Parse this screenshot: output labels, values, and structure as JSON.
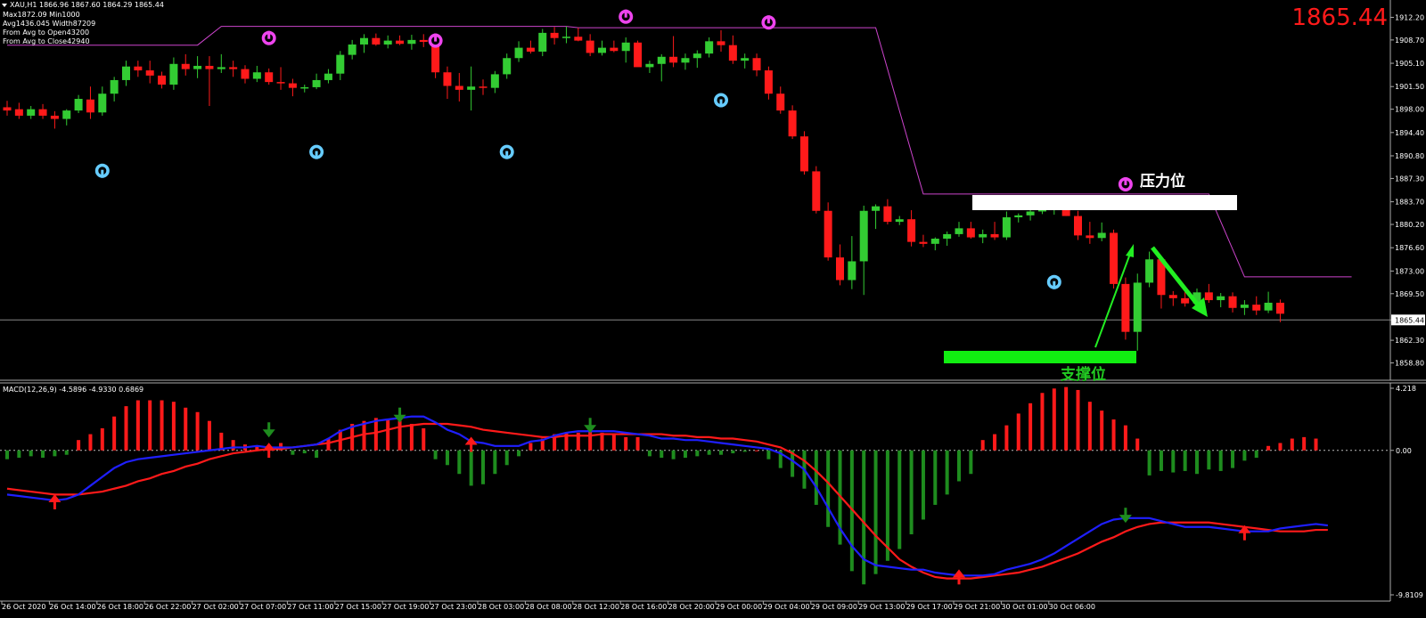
{
  "header": {
    "symbol_line": "XAU,H1  1866.96 1867.60 1864.29 1865.44",
    "info_lines": [
      "Max1872.09 Min1000",
      "Avg1436.045 Width87209",
      "From Avg to Open43200",
      "From Avg to Close42940"
    ],
    "big_price": "1865.44"
  },
  "annotations": {
    "resistance_label": "压力位",
    "support_label": "支撑位"
  },
  "colors": {
    "bull": "#33cc33",
    "bear": "#ff1a1a",
    "macd_blue": "#1f1fff",
    "macd_red": "#ff1a1a",
    "trail": "#cc44cc",
    "fractal_up": "#66ccff",
    "fractal_down": "#ee44ee",
    "grid": "#888888"
  },
  "macd_header": "MACD(12,26,9) -4.5896 -4.9330 0.6869",
  "chart_data": [
    {
      "type": "candlestick",
      "symbol": "XAU",
      "timeframe": "H1",
      "ylim": [
        1857.5,
        1913.5
      ],
      "yticks": [
        "1912.20",
        "1908.70",
        "1905.10",
        "1901.50",
        "1898.00",
        "1894.40",
        "1890.80",
        "1887.30",
        "1883.70",
        "1880.20",
        "1876.60",
        "1873.00",
        "1869.50",
        "1865.44",
        "1862.30",
        "1858.80"
      ],
      "current_price": 1865.44,
      "xticks": [
        "26 Oct 2020",
        "26 Oct 14:00",
        "26 Oct 18:00",
        "26 Oct 22:00",
        "27 Oct 02:00",
        "27 Oct 07:00",
        "27 Oct 11:00",
        "27 Oct 15:00",
        "27 Oct 19:00",
        "27 Oct 23:00",
        "28 Oct 03:00",
        "28 Oct 08:00",
        "28 Oct 12:00",
        "28 Oct 16:00",
        "28 Oct 20:00",
        "29 Oct 00:00",
        "29 Oct 04:00",
        "29 Oct 09:00",
        "29 Oct 13:00",
        "29 Oct 17:00",
        "29 Oct 21:00",
        "30 Oct 01:00",
        "30 Oct 06:00"
      ],
      "candles": [
        [
          1898.3,
          1899.3,
          1897.0,
          1897.8
        ],
        [
          1898.0,
          1899.0,
          1896.5,
          1897.0
        ],
        [
          1897.0,
          1898.5,
          1896.5,
          1898.0
        ],
        [
          1898.0,
          1898.8,
          1896.5,
          1897.0
        ],
        [
          1897.0,
          1897.7,
          1895.0,
          1896.5
        ],
        [
          1896.5,
          1898.0,
          1895.5,
          1897.8
        ],
        [
          1897.8,
          1900.2,
          1897.4,
          1899.6
        ],
        [
          1899.5,
          1901.5,
          1896.5,
          1897.5
        ],
        [
          1897.5,
          1901.5,
          1897.0,
          1900.4
        ],
        [
          1900.4,
          1903.0,
          1899.2,
          1902.5
        ],
        [
          1902.5,
          1905.5,
          1901.6,
          1904.6
        ],
        [
          1904.6,
          1905.5,
          1903.0,
          1904.0
        ],
        [
          1904.0,
          1905.5,
          1902.0,
          1903.2
        ],
        [
          1903.2,
          1903.8,
          1901.2,
          1901.8
        ],
        [
          1901.8,
          1906.0,
          1901.0,
          1905.0
        ],
        [
          1905.0,
          1906.5,
          1903.2,
          1904.2
        ],
        [
          1904.2,
          1906.2,
          1902.8,
          1904.7
        ],
        [
          1904.7,
          1906.2,
          1898.5,
          1904.2
        ],
        [
          1904.2,
          1906.5,
          1903.6,
          1904.5
        ],
        [
          1904.5,
          1905.5,
          1903.0,
          1904.2
        ],
        [
          1904.2,
          1904.8,
          1902.0,
          1902.7
        ],
        [
          1902.7,
          1904.7,
          1902.2,
          1903.7
        ],
        [
          1903.7,
          1904.3,
          1901.8,
          1902.2
        ],
        [
          1902.2,
          1904.5,
          1901.0,
          1902.0
        ],
        [
          1902.0,
          1902.7,
          1900.0,
          1901.3
        ],
        [
          1901.3,
          1901.8,
          1900.6,
          1901.4
        ],
        [
          1901.4,
          1903.5,
          1901.1,
          1902.5
        ],
        [
          1902.5,
          1904.2,
          1902.0,
          1903.5
        ],
        [
          1903.5,
          1907.0,
          1902.5,
          1906.4
        ],
        [
          1906.4,
          1908.7,
          1905.7,
          1908.0
        ],
        [
          1908.0,
          1909.6,
          1906.7,
          1909.0
        ],
        [
          1909.0,
          1909.7,
          1907.8,
          1908.0
        ],
        [
          1908.0,
          1909.4,
          1907.4,
          1908.6
        ],
        [
          1908.6,
          1909.4,
          1907.9,
          1908.1
        ],
        [
          1908.1,
          1909.5,
          1907.2,
          1908.7
        ],
        [
          1908.7,
          1909.6,
          1907.6,
          1908.4
        ],
        [
          1908.4,
          1909.5,
          1902.8,
          1903.7
        ],
        [
          1903.7,
          1904.6,
          1899.6,
          1901.6
        ],
        [
          1901.6,
          1903.6,
          1899.2,
          1901.0
        ],
        [
          1901.0,
          1904.6,
          1897.8,
          1901.5
        ],
        [
          1901.5,
          1902.6,
          1900.2,
          1901.3
        ],
        [
          1901.3,
          1903.9,
          1900.5,
          1903.4
        ],
        [
          1903.4,
          1906.6,
          1902.7,
          1905.9
        ],
        [
          1905.9,
          1908.5,
          1905.3,
          1907.5
        ],
        [
          1907.5,
          1908.6,
          1906.6,
          1906.9
        ],
        [
          1906.9,
          1910.4,
          1906.2,
          1909.8
        ],
        [
          1909.8,
          1910.7,
          1908.0,
          1909.0
        ],
        [
          1909.0,
          1910.8,
          1908.2,
          1909.2
        ],
        [
          1909.2,
          1910.6,
          1908.5,
          1908.6
        ],
        [
          1908.6,
          1909.6,
          1906.2,
          1906.7
        ],
        [
          1906.7,
          1908.6,
          1906.3,
          1907.5
        ],
        [
          1907.5,
          1908.6,
          1906.8,
          1907.0
        ],
        [
          1907.0,
          1909.1,
          1905.2,
          1908.3
        ],
        [
          1908.3,
          1908.6,
          1905.0,
          1904.5
        ],
        [
          1904.5,
          1905.5,
          1903.6,
          1905.0
        ],
        [
          1905.0,
          1906.5,
          1902.3,
          1906.1
        ],
        [
          1906.1,
          1909.3,
          1904.5,
          1905.2
        ],
        [
          1905.2,
          1906.6,
          1904.1,
          1905.9
        ],
        [
          1905.9,
          1907.1,
          1904.4,
          1906.6
        ],
        [
          1906.6,
          1909.1,
          1906.0,
          1908.5
        ],
        [
          1908.5,
          1910.2,
          1906.9,
          1907.9
        ],
        [
          1907.9,
          1909.4,
          1905.0,
          1905.5
        ],
        [
          1905.5,
          1906.6,
          1904.3,
          1905.9
        ],
        [
          1905.9,
          1906.6,
          1903.1,
          1904.0
        ],
        [
          1904.0,
          1904.6,
          1899.5,
          1900.4
        ],
        [
          1900.4,
          1901.5,
          1897.3,
          1897.8
        ],
        [
          1897.8,
          1898.6,
          1893.4,
          1893.8
        ],
        [
          1893.8,
          1894.6,
          1887.9,
          1888.4
        ],
        [
          1888.4,
          1889.2,
          1881.9,
          1882.3
        ],
        [
          1882.3,
          1883.6,
          1874.6,
          1875.1
        ],
        [
          1875.1,
          1877.1,
          1870.8,
          1871.6
        ],
        [
          1871.6,
          1878.4,
          1870.2,
          1874.5
        ],
        [
          1874.5,
          1883.1,
          1869.3,
          1882.3
        ],
        [
          1882.3,
          1883.3,
          1879.5,
          1883.0
        ],
        [
          1883.0,
          1884.1,
          1880.2,
          1880.6
        ],
        [
          1880.6,
          1881.5,
          1880.1,
          1881.0
        ],
        [
          1881.0,
          1882.4,
          1876.8,
          1877.5
        ],
        [
          1877.5,
          1878.6,
          1876.7,
          1877.2
        ],
        [
          1877.2,
          1878.2,
          1876.2,
          1878.0
        ],
        [
          1878.0,
          1879.1,
          1876.9,
          1878.7
        ],
        [
          1878.7,
          1880.6,
          1878.3,
          1879.6
        ],
        [
          1879.6,
          1880.6,
          1878.0,
          1878.2
        ],
        [
          1878.2,
          1879.4,
          1877.3,
          1878.7
        ],
        [
          1878.7,
          1880.6,
          1877.8,
          1878.2
        ],
        [
          1878.2,
          1882.2,
          1877.8,
          1881.3
        ],
        [
          1881.3,
          1881.9,
          1880.5,
          1881.6
        ],
        [
          1881.6,
          1882.7,
          1880.8,
          1882.2
        ],
        [
          1882.2,
          1883.4,
          1881.8,
          1882.5
        ],
        [
          1882.5,
          1884.5,
          1881.7,
          1883.2
        ],
        [
          1883.2,
          1884.0,
          1881.5,
          1881.5
        ],
        [
          1881.5,
          1882.3,
          1877.8,
          1878.5
        ],
        [
          1878.5,
          1880.6,
          1877.2,
          1878.1
        ],
        [
          1878.1,
          1880.5,
          1877.6,
          1878.9
        ],
        [
          1878.9,
          1879.4,
          1870.3,
          1871.0
        ],
        [
          1871.0,
          1872.0,
          1862.4,
          1863.6
        ],
        [
          1863.6,
          1872.6,
          1860.7,
          1871.2
        ],
        [
          1871.2,
          1876.0,
          1870.5,
          1874.8
        ],
        [
          1874.8,
          1875.3,
          1867.2,
          1869.3
        ],
        [
          1869.3,
          1869.9,
          1867.6,
          1868.8
        ],
        [
          1868.8,
          1869.8,
          1867.5,
          1868.0
        ],
        [
          1868.0,
          1870.3,
          1867.5,
          1869.7
        ],
        [
          1869.7,
          1871.0,
          1868.1,
          1868.5
        ],
        [
          1868.5,
          1869.6,
          1867.4,
          1869.1
        ],
        [
          1869.1,
          1869.7,
          1866.6,
          1867.3
        ],
        [
          1867.3,
          1868.5,
          1866.2,
          1867.8
        ],
        [
          1867.8,
          1869.1,
          1866.2,
          1866.9
        ],
        [
          1866.9,
          1869.8,
          1866.5,
          1868.1
        ],
        [
          1868.1,
          1868.6,
          1865.1,
          1866.4
        ]
      ],
      "fractals_up": [
        [
          8,
          1888.5
        ],
        [
          26,
          1891.4
        ],
        [
          42,
          1891.4
        ],
        [
          60,
          1899.4
        ],
        [
          88,
          1871.3
        ]
      ],
      "fractals_down": [
        [
          22,
          1909.0
        ],
        [
          36,
          1908.6
        ],
        [
          52,
          1912.3
        ],
        [
          64,
          1911.4
        ],
        [
          94,
          1886.4
        ]
      ],
      "trailing_line": [
        [
          0,
          1907.9
        ],
        [
          16,
          1907.9
        ],
        [
          18,
          1910.8
        ],
        [
          47,
          1910.8
        ],
        [
          48,
          1910.6
        ],
        [
          73,
          1910.6
        ],
        [
          77,
          1884.9
        ],
        [
          101,
          1884.9
        ],
        [
          104,
          1872.1
        ],
        [
          113,
          1872.1
        ]
      ],
      "resistance_zone": [
        1884.9,
        1883.0
      ],
      "support_zone": [
        1863.1,
        1861.6
      ]
    },
    {
      "type": "macd",
      "params": "MACD(12,26,9)",
      "values": {
        "main": -4.5896,
        "signal": -4.933,
        "histogram": 0.6869
      },
      "ylim": [
        -9.8109,
        4.218
      ],
      "yticks": [
        "4.218",
        "0.00",
        "-9.8109"
      ],
      "histogram": [
        -0.6,
        -0.5,
        -0.4,
        -0.5,
        -0.4,
        -0.3,
        0.7,
        1.1,
        1.5,
        2.3,
        3.0,
        3.4,
        3.4,
        3.4,
        3.3,
        2.9,
        2.6,
        2.0,
        1.2,
        0.7,
        0.4,
        0.3,
        0.2,
        0.5,
        -0.3,
        -0.2,
        -0.5,
        0.8,
        1.4,
        1.8,
        2.0,
        2.2,
        2.1,
        2.0,
        1.8,
        1.5,
        -0.6,
        -1.0,
        -1.6,
        -2.4,
        -2.3,
        -1.6,
        -1.0,
        -0.4,
        0.5,
        0.8,
        1.1,
        1.2,
        1.2,
        1.3,
        1.2,
        1.1,
        0.9,
        0.9,
        -0.4,
        -0.5,
        -0.6,
        -0.5,
        -0.4,
        -0.3,
        -0.3,
        -0.2,
        -0.1,
        0.0,
        -0.6,
        -1.2,
        -1.8,
        -2.6,
        -3.7,
        -5.2,
        -6.4,
        -8.2,
        -9.1,
        -8.4,
        -7.5,
        -6.7,
        -5.7,
        -4.7,
        -3.7,
        -3.0,
        -2.1,
        -1.6,
        0.7,
        1.1,
        1.7,
        2.5,
        3.2,
        3.9,
        4.2,
        4.3,
        4.1,
        3.3,
        2.7,
        2.1,
        1.7,
        0.8,
        -1.7,
        -1.4,
        -1.5,
        -1.4,
        -1.6,
        -1.3,
        -1.4,
        -1.2,
        -0.7,
        -0.5,
        0.3,
        0.5,
        0.8,
        0.9,
        0.8
      ],
      "main": [
        -3.0,
        -3.1,
        -3.2,
        -3.3,
        -3.4,
        -3.3,
        -3.0,
        -2.4,
        -1.8,
        -1.2,
        -0.8,
        -0.6,
        -0.5,
        -0.4,
        -0.3,
        -0.2,
        -0.1,
        0.0,
        0.1,
        0.2,
        0.2,
        0.3,
        0.2,
        0.2,
        0.2,
        0.3,
        0.4,
        0.8,
        1.3,
        1.6,
        1.8,
        2.0,
        2.1,
        2.2,
        2.3,
        2.3,
        1.9,
        1.4,
        1.1,
        0.6,
        0.5,
        0.3,
        0.3,
        0.3,
        0.6,
        0.7,
        1.0,
        1.2,
        1.3,
        1.3,
        1.3,
        1.3,
        1.2,
        1.1,
        1.0,
        0.8,
        0.8,
        0.7,
        0.7,
        0.6,
        0.5,
        0.4,
        0.3,
        0.2,
        0.1,
        -0.2,
        -0.7,
        -1.3,
        -2.5,
        -3.9,
        -5.3,
        -6.5,
        -7.4,
        -7.8,
        -7.9,
        -8.0,
        -8.1,
        -8.1,
        -8.3,
        -8.4,
        -8.5,
        -8.5,
        -8.5,
        -8.4,
        -8.1,
        -7.9,
        -7.7,
        -7.4,
        -7.0,
        -6.5,
        -6.0,
        -5.5,
        -5.0,
        -4.7,
        -4.6,
        -4.6,
        -4.6,
        -4.8,
        -5.0,
        -5.2,
        -5.2,
        -5.2,
        -5.3,
        -5.4,
        -5.5,
        -5.5,
        -5.5,
        -5.3,
        -5.2,
        -5.1,
        -5.0,
        -5.1
      ],
      "signal": [
        -2.6,
        -2.7,
        -2.8,
        -2.9,
        -3.0,
        -3.0,
        -3.0,
        -2.9,
        -2.8,
        -2.6,
        -2.4,
        -2.1,
        -1.9,
        -1.6,
        -1.4,
        -1.1,
        -0.9,
        -0.6,
        -0.4,
        -0.2,
        -0.1,
        0.0,
        0.1,
        0.1,
        0.2,
        0.3,
        0.4,
        0.5,
        0.7,
        0.9,
        1.1,
        1.2,
        1.4,
        1.6,
        1.7,
        1.8,
        1.8,
        1.8,
        1.7,
        1.6,
        1.4,
        1.3,
        1.2,
        1.1,
        1.0,
        0.9,
        0.9,
        1.0,
        1.0,
        1.0,
        1.1,
        1.1,
        1.1,
        1.1,
        1.1,
        1.1,
        1.0,
        1.0,
        0.9,
        0.9,
        0.8,
        0.8,
        0.7,
        0.6,
        0.4,
        0.2,
        -0.2,
        -0.7,
        -1.4,
        -2.2,
        -3.1,
        -4.0,
        -4.9,
        -5.8,
        -6.6,
        -7.4,
        -7.9,
        -8.3,
        -8.6,
        -8.7,
        -8.7,
        -8.7,
        -8.6,
        -8.5,
        -8.4,
        -8.3,
        -8.1,
        -7.9,
        -7.6,
        -7.3,
        -7.0,
        -6.6,
        -6.2,
        -5.9,
        -5.5,
        -5.2,
        -5.0,
        -4.9,
        -4.9,
        -4.9,
        -4.9,
        -4.9,
        -5.0,
        -5.1,
        -5.2,
        -5.3,
        -5.4,
        -5.5,
        -5.5,
        -5.5,
        -5.4,
        -5.4
      ],
      "arrows_up": [
        [
          4,
          -3.4
        ],
        [
          22,
          0.1
        ],
        [
          39,
          0.5
        ],
        [
          80,
          -8.5
        ],
        [
          104,
          -5.5
        ]
      ],
      "arrows_down": [
        [
          22,
          1.3
        ],
        [
          33,
          2.3
        ],
        [
          49,
          1.6
        ],
        [
          94,
          -4.5
        ]
      ]
    }
  ]
}
